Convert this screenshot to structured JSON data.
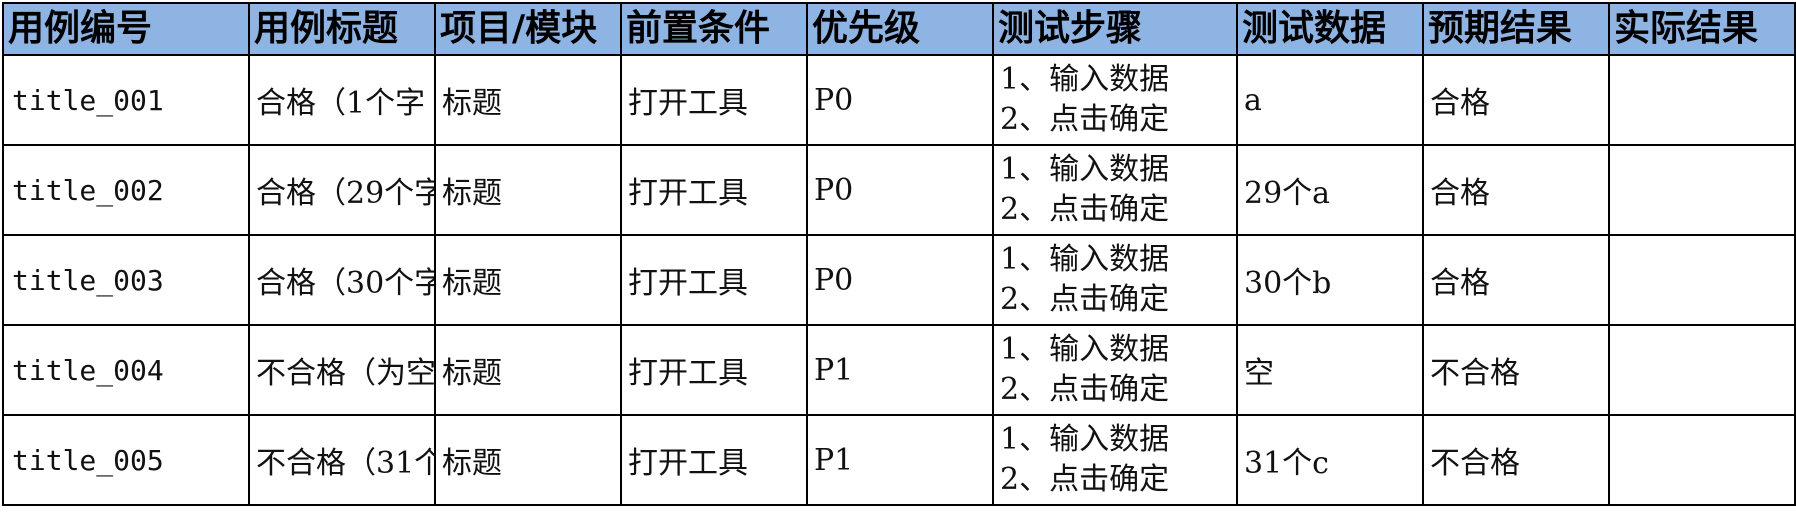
{
  "table": {
    "headers": [
      "用例编号",
      "用例标题",
      "项目/模块",
      "前置条件",
      "优先级",
      "测试步骤",
      "测试数据",
      "预期结果",
      "实际结果"
    ],
    "rows": [
      {
        "id": "title_001",
        "title": "合格（1个字",
        "module": "标题",
        "precondition": "打开工具",
        "priority": "P0",
        "step1": "1、输入数据",
        "step2": "2、点击确定",
        "data": "a",
        "expected": "合格",
        "actual": ""
      },
      {
        "id": "title_002",
        "title": "合格（29个字",
        "module": "标题",
        "precondition": "打开工具",
        "priority": "P0",
        "step1": "1、输入数据",
        "step2": "2、点击确定",
        "data": "29个a",
        "expected": "合格",
        "actual": ""
      },
      {
        "id": "title_003",
        "title": "合格（30个字",
        "module": "标题",
        "precondition": "打开工具",
        "priority": "P0",
        "step1": "1、输入数据",
        "step2": "2、点击确定",
        "data": "30个b",
        "expected": "合格",
        "actual": ""
      },
      {
        "id": "title_004",
        "title": "不合格（为空",
        "module": "标题",
        "precondition": "打开工具",
        "priority": "P1",
        "step1": "1、输入数据",
        "step2": "2、点击确定",
        "data": "空",
        "expected": "不合格",
        "actual": ""
      },
      {
        "id": "title_005",
        "title": "不合格（31个",
        "module": "标题",
        "precondition": "打开工具",
        "priority": "P1",
        "step1": "1、输入数据",
        "step2": "2、点击确定",
        "data": "31个c",
        "expected": "不合格",
        "actual": ""
      }
    ]
  }
}
